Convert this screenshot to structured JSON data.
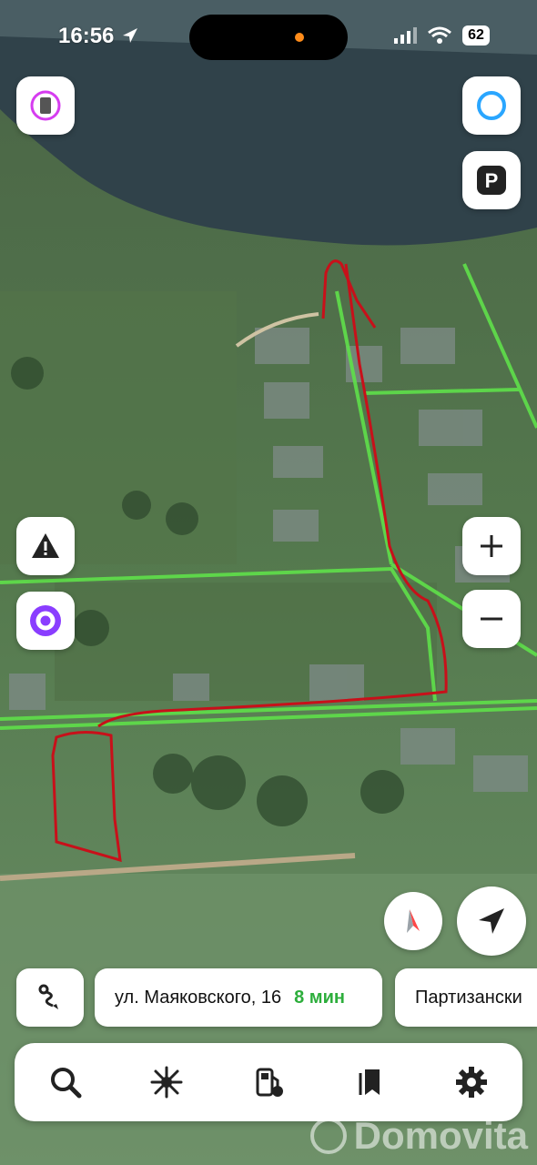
{
  "status_bar": {
    "time": "16:56",
    "battery": "62"
  },
  "map": {
    "top_right_buttons": [
      "alice-ring-icon",
      "parking-icon"
    ],
    "parking_label": "P"
  },
  "route_chips": [
    {
      "destination": "ул. Маяковского, 16",
      "duration": "8 мин"
    },
    {
      "destination": "Партизански",
      "duration": ""
    }
  ],
  "watermark": "Domovita",
  "colors": {
    "accent_green": "#2dae3c",
    "road_green": "#5fe04a",
    "drawn_route": "#c8101a",
    "alice_purple": "#8a3dff"
  },
  "bottom_nav": [
    "search-icon",
    "discover-icon",
    "fuel-icon",
    "bookmarks-icon",
    "settings-icon"
  ]
}
